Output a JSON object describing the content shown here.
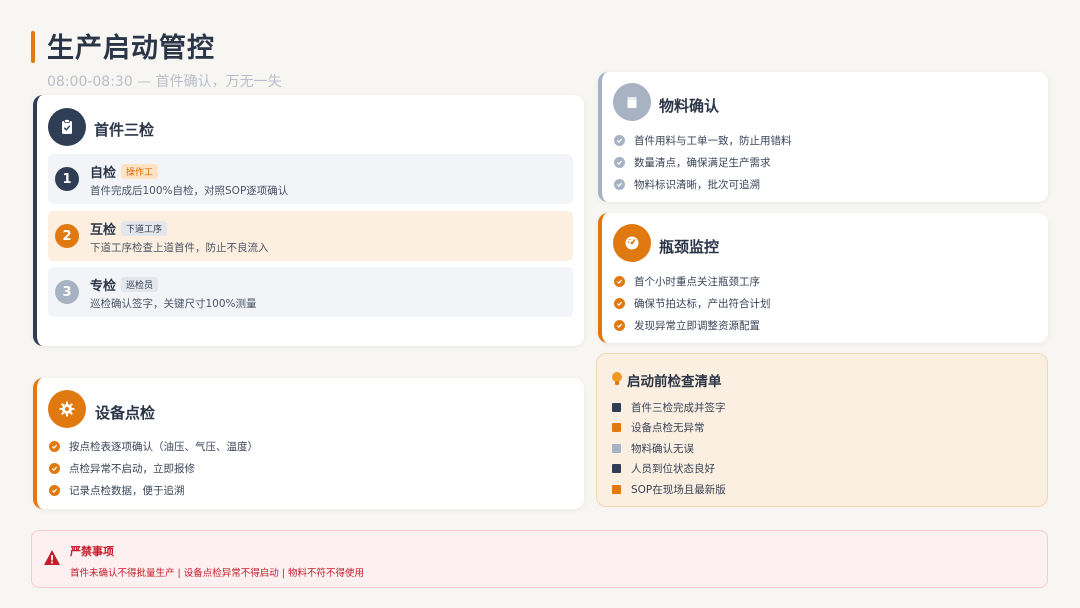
{
  "header": {
    "title": "生产启动管控",
    "subtitle": "08:00-08:30 — 首件确认，万无一失"
  },
  "first_article": {
    "title": "首件三检",
    "icon": "clipboard-check-icon",
    "steps": [
      {
        "num": "1",
        "name": "自检",
        "tag": "操作工",
        "desc": "首件完成后100%自检，对照SOP逐项确认"
      },
      {
        "num": "2",
        "name": "互检",
        "tag": "下道工序",
        "desc": "下道工序检查上道首件，防止不良流入"
      },
      {
        "num": "3",
        "name": "专检",
        "tag": "巡检员",
        "desc": "巡检确认签字，关键尺寸100%测量"
      }
    ]
  },
  "equipment": {
    "title": "设备点检",
    "icon": "gear-icon",
    "items": [
      "按点检表逐项确认（油压、气压、温度）",
      "点检异常不启动，立即报修",
      "记录点检数据，便于追溯"
    ]
  },
  "material": {
    "title": "物料确认",
    "icon": "box-icon",
    "items": [
      "首件用料与工单一致，防止用错料",
      "数量清点，确保满足生产需求",
      "物料标识清晰，批次可追溯"
    ]
  },
  "bottleneck": {
    "title": "瓶颈监控",
    "icon": "gauge-icon",
    "items": [
      "首个小时重点关注瓶颈工序",
      "确保节拍达标，产出符合计划",
      "发现异常立即调整资源配置"
    ]
  },
  "checklist": {
    "title": "启动前检查清单",
    "icon": "lightbulb-icon",
    "items": [
      "首件三检完成并签字",
      "设备点检无异常",
      "物料确认无误",
      "人员到位状态良好",
      "SOP在现场且最新版"
    ]
  },
  "warning": {
    "title": "严禁事项",
    "icon": "warning-triangle-icon",
    "text": "首件未确认不得批量生产 | 设备点检异常不得启动 | 物料不符不得使用"
  },
  "colors": {
    "accent": "#e07a10",
    "navy": "#2f3d55",
    "grey": "#a7b2c3",
    "danger": "#c61b2a"
  }
}
